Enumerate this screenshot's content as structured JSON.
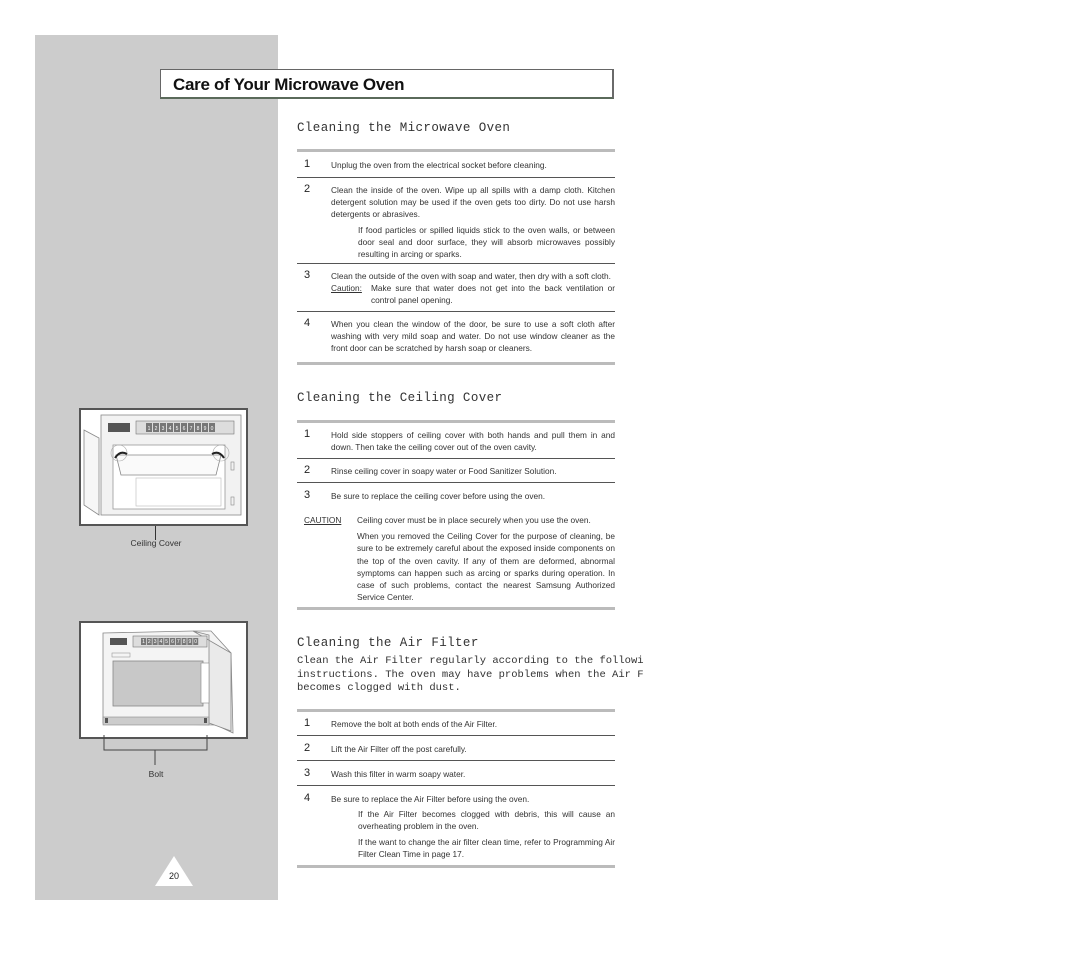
{
  "page": {
    "title": "Care of Your Microwave Oven",
    "page_number": "20"
  },
  "figures": {
    "ceiling_cover": {
      "caption": "Ceiling Cover",
      "keypad": [
        "1",
        "2",
        "3",
        "4",
        "5",
        "6",
        "7",
        "8",
        "9",
        "0"
      ]
    },
    "bolt": {
      "caption": "Bolt",
      "keypad": [
        "1",
        "2",
        "3",
        "4",
        "5",
        "6",
        "7",
        "8",
        "9",
        "0"
      ]
    }
  },
  "sections": {
    "microwave": {
      "title": "Cleaning the Microwave Oven",
      "steps": [
        {
          "num": "1",
          "text": "Unplug the oven from the electrical socket before cleaning."
        },
        {
          "num": "2",
          "text": "Clean the inside of the oven. Wipe up all spills with a damp cloth. Kitchen detergent solution may be used if the oven gets too dirty. Do not use harsh detergents or abrasives.",
          "note": "If food particles or spilled liquids stick to the oven walls, or between door seal and door surface, they will absorb microwaves possibly resulting in arcing or sparks."
        },
        {
          "num": "3",
          "text": "Clean the outside of the oven with soap and water, then dry with a soft cloth.",
          "caution_label": "Caution:",
          "caution_text": "Make sure that water does not get into the back ventilation or control panel opening."
        },
        {
          "num": "4",
          "text": "When you clean the window of the door, be sure to use a soft cloth after washing with very mild soap and water. Do not use window cleaner as the front door can be scratched by harsh soap or cleaners."
        }
      ]
    },
    "ceiling": {
      "title": "Cleaning the Ceiling Cover",
      "steps": [
        {
          "num": "1",
          "text": "Hold side stoppers of ceiling cover with both hands and pull them in and down. Then take the ceiling cover out of the oven cavity."
        },
        {
          "num": "2",
          "text": "Rinse ceiling cover in soapy water or Food Sanitizer Solution."
        },
        {
          "num": "3",
          "text": "Be sure to replace the ceiling cover before using the oven."
        }
      ],
      "caution": {
        "label": "CAUTION",
        "lines": [
          "Ceiling cover must be in place securely when you use the oven.",
          "When you removed the Ceiling Cover for the purpose of cleaning, be sure to be extremely careful about the exposed inside components on the top of the oven cavity. If any of them are deformed, abnormal symptoms can happen such as arcing or sparks during operation. In case of such problems, contact the nearest Samsung Authorized Service Center."
        ]
      }
    },
    "air_filter": {
      "title": "Cleaning the Air Filter",
      "intro": [
        "Clean the Air Filter regularly according to the followi",
        "instructions. The oven may have problems when the Air F",
        "becomes clogged with dust."
      ],
      "steps": [
        {
          "num": "1",
          "text": "Remove the bolt at both ends of the Air Filter."
        },
        {
          "num": "2",
          "text": "Lift the Air Filter off the post carefully."
        },
        {
          "num": "3",
          "text": "Wash this filter in warm soapy water."
        },
        {
          "num": "4",
          "text": "Be sure to replace the Air Filter before using the oven.",
          "notes": [
            "If the Air Filter becomes clogged with debris, this will cause an overheating problem in the oven.",
            "If the want to change the air filter clean time, refer to  Programming Air Filter Clean Time  in page 17."
          ]
        }
      ]
    }
  }
}
